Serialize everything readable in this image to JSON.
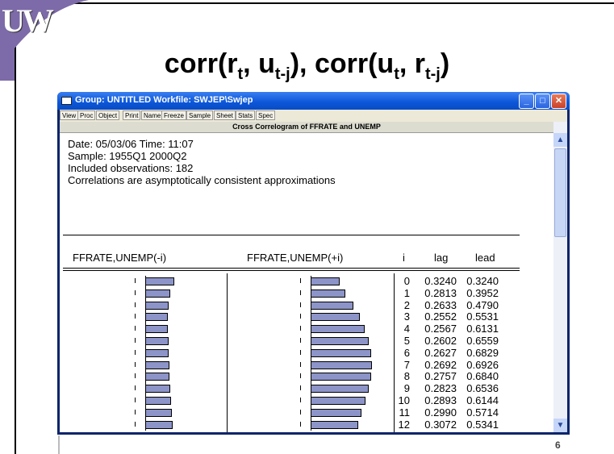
{
  "slide": {
    "logo": "UW",
    "title_main": "corr(r",
    "title_sub1": "t",
    "title_mid1": ", u",
    "title_sub2": "t-j",
    "title_mid2": "), corr(u",
    "title_sub3": "t",
    "title_mid3": ", r",
    "title_sub4": "t-j",
    "title_end": ")",
    "page_number": "6"
  },
  "window": {
    "title": "Group: UNTITLED   Workfile: SWJEP\\Swjep",
    "toolbar": [
      "View",
      "Proc",
      "Object",
      "Print",
      "Name",
      "Freeze",
      "Sample",
      "Sheet",
      "Stats",
      "Spec"
    ],
    "header": "Cross Correlogram of FFRATE and UNEMP",
    "info": [
      "Date: 05/03/06   Time: 11:07",
      "Sample: 1955Q1 2000Q2",
      "Included observations: 182",
      "Correlations are asymptotically consistent approximations"
    ],
    "columns": {
      "left": "FFRATE,UNEMP(-i)",
      "right": "FFRATE,UNEMP(+i)",
      "i": "i",
      "lag": "lag",
      "lead": "lead"
    }
  },
  "chart_data": {
    "type": "table",
    "columns": [
      "i",
      "lag",
      "lead"
    ],
    "rows": [
      [
        "0",
        "0.3240",
        "0.3240"
      ],
      [
        "1",
        "0.2813",
        "0.3952"
      ],
      [
        "2",
        "0.2633",
        "0.4790"
      ],
      [
        "3",
        "0.2552",
        "0.5531"
      ],
      [
        "4",
        "0.2567",
        "0.6131"
      ],
      [
        "5",
        "0.2602",
        "0.6559"
      ],
      [
        "6",
        "0.2627",
        "0.6829"
      ],
      [
        "7",
        "0.2692",
        "0.6926"
      ],
      [
        "8",
        "0.2757",
        "0.6840"
      ],
      [
        "9",
        "0.2823",
        "0.6536"
      ],
      [
        "10",
        "0.2893",
        "0.6144"
      ],
      [
        "11",
        "0.2990",
        "0.5714"
      ],
      [
        "12",
        "0.3072",
        "0.5341"
      ]
    ]
  }
}
